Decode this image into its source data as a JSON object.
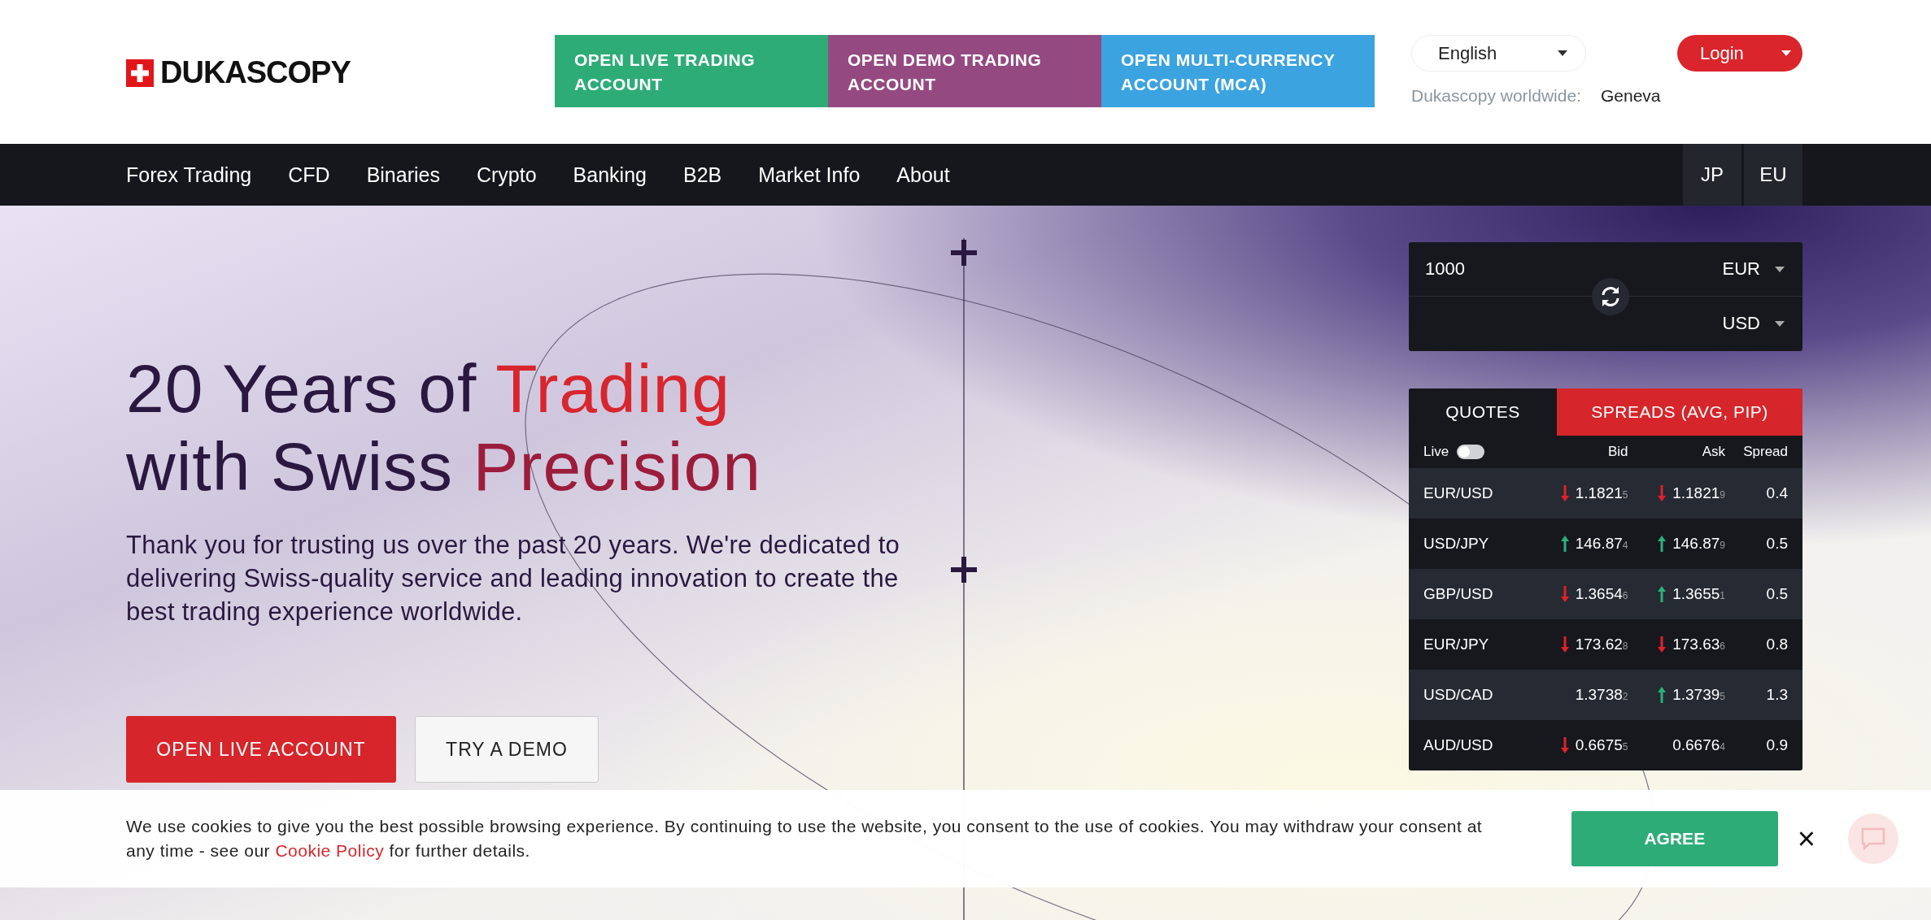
{
  "header": {
    "logo": "DUKASCOPY",
    "account_buttons": [
      {
        "label": "OPEN LIVE TRADING ACCOUNT",
        "color": "#2eac78"
      },
      {
        "label": "OPEN DEMO TRADING ACCOUNT",
        "color": "#944a80"
      },
      {
        "label": "OPEN MULTI-CURRENCY ACCOUNT (MCA)",
        "color": "#3ba3e0"
      }
    ],
    "language": "English",
    "login": "Login",
    "worldwide_label": "Dukascopy worldwide:",
    "worldwide_value": "Geneva"
  },
  "nav": {
    "items": [
      "Forex Trading",
      "CFD",
      "Binaries",
      "Crypto",
      "Banking",
      "B2B",
      "Market Info",
      "About"
    ],
    "regions": [
      "JP",
      "EU"
    ]
  },
  "hero": {
    "title_lines": [
      [
        {
          "text": "20 Years of ",
          "color": "#2a1840"
        },
        {
          "text": "Trading",
          "color": "#d8262e"
        }
      ],
      [
        {
          "text": "with Swiss ",
          "color": "#2a1840"
        },
        {
          "text": "Precision",
          "color": "#9c1c3c"
        }
      ]
    ],
    "text": "Thank you for trusting us over the past 20 years. We're dedicated to delivering Swiss-quality service and leading innovation to create the best trading experience worldwide.",
    "buttons": [
      {
        "label": "OPEN LIVE ACCOUNT",
        "kind": "primary"
      },
      {
        "label": "TRY A DEMO",
        "kind": "secondary"
      }
    ]
  },
  "converter": {
    "amount": "1000",
    "from": "EUR",
    "to": "USD"
  },
  "quotes": {
    "tabs": [
      {
        "label": "QUOTES",
        "selected": true
      },
      {
        "label": "SPREADS (AVG, PIP)",
        "selected": false
      }
    ],
    "live_label": "Live",
    "live_on": false,
    "columns": [
      "Bid",
      "Ask",
      "Spread"
    ],
    "rows": [
      {
        "pair": "EUR/USD",
        "bid": {
          "kind": "down",
          "price": "1.1821",
          "pip": "5"
        },
        "ask": {
          "kind": "down",
          "price": "1.1821",
          "pip": "9"
        },
        "spread": "0.4"
      },
      {
        "pair": "USD/JPY",
        "bid": {
          "kind": "up",
          "price": "146.87",
          "pip": "4"
        },
        "ask": {
          "kind": "up",
          "price": "146.87",
          "pip": "9"
        },
        "spread": "0.5"
      },
      {
        "pair": "GBP/USD",
        "bid": {
          "kind": "down",
          "price": "1.3654",
          "pip": "6"
        },
        "ask": {
          "kind": "up",
          "price": "1.3655",
          "pip": "1"
        },
        "spread": "0.5"
      },
      {
        "pair": "EUR/JPY",
        "bid": {
          "kind": "down",
          "price": "173.62",
          "pip": "8"
        },
        "ask": {
          "kind": "down",
          "price": "173.63",
          "pip": "6"
        },
        "spread": "0.8"
      },
      {
        "pair": "USD/CAD",
        "bid": {
          "price": "1.3738",
          "pip": "2"
        },
        "ask": {
          "kind": "up",
          "price": "1.3739",
          "pip": "5"
        },
        "spread": "1.3"
      },
      {
        "pair": "AUD/USD",
        "bid": {
          "kind": "down",
          "price": "0.6675",
          "pip": "5"
        },
        "ask": {
          "price": "0.6676",
          "pip": "4"
        },
        "spread": "0.9"
      }
    ]
  },
  "cookie_bar": {
    "text_before": "We use cookies to give you the best possible browsing experience. By continuing to use the website, you consent to the use of cookies. You may withdraw your consent at any time - see our ",
    "link": "Cookie Policy",
    "text_after": " for further details.",
    "button": "AGREE",
    "close": "×"
  }
}
